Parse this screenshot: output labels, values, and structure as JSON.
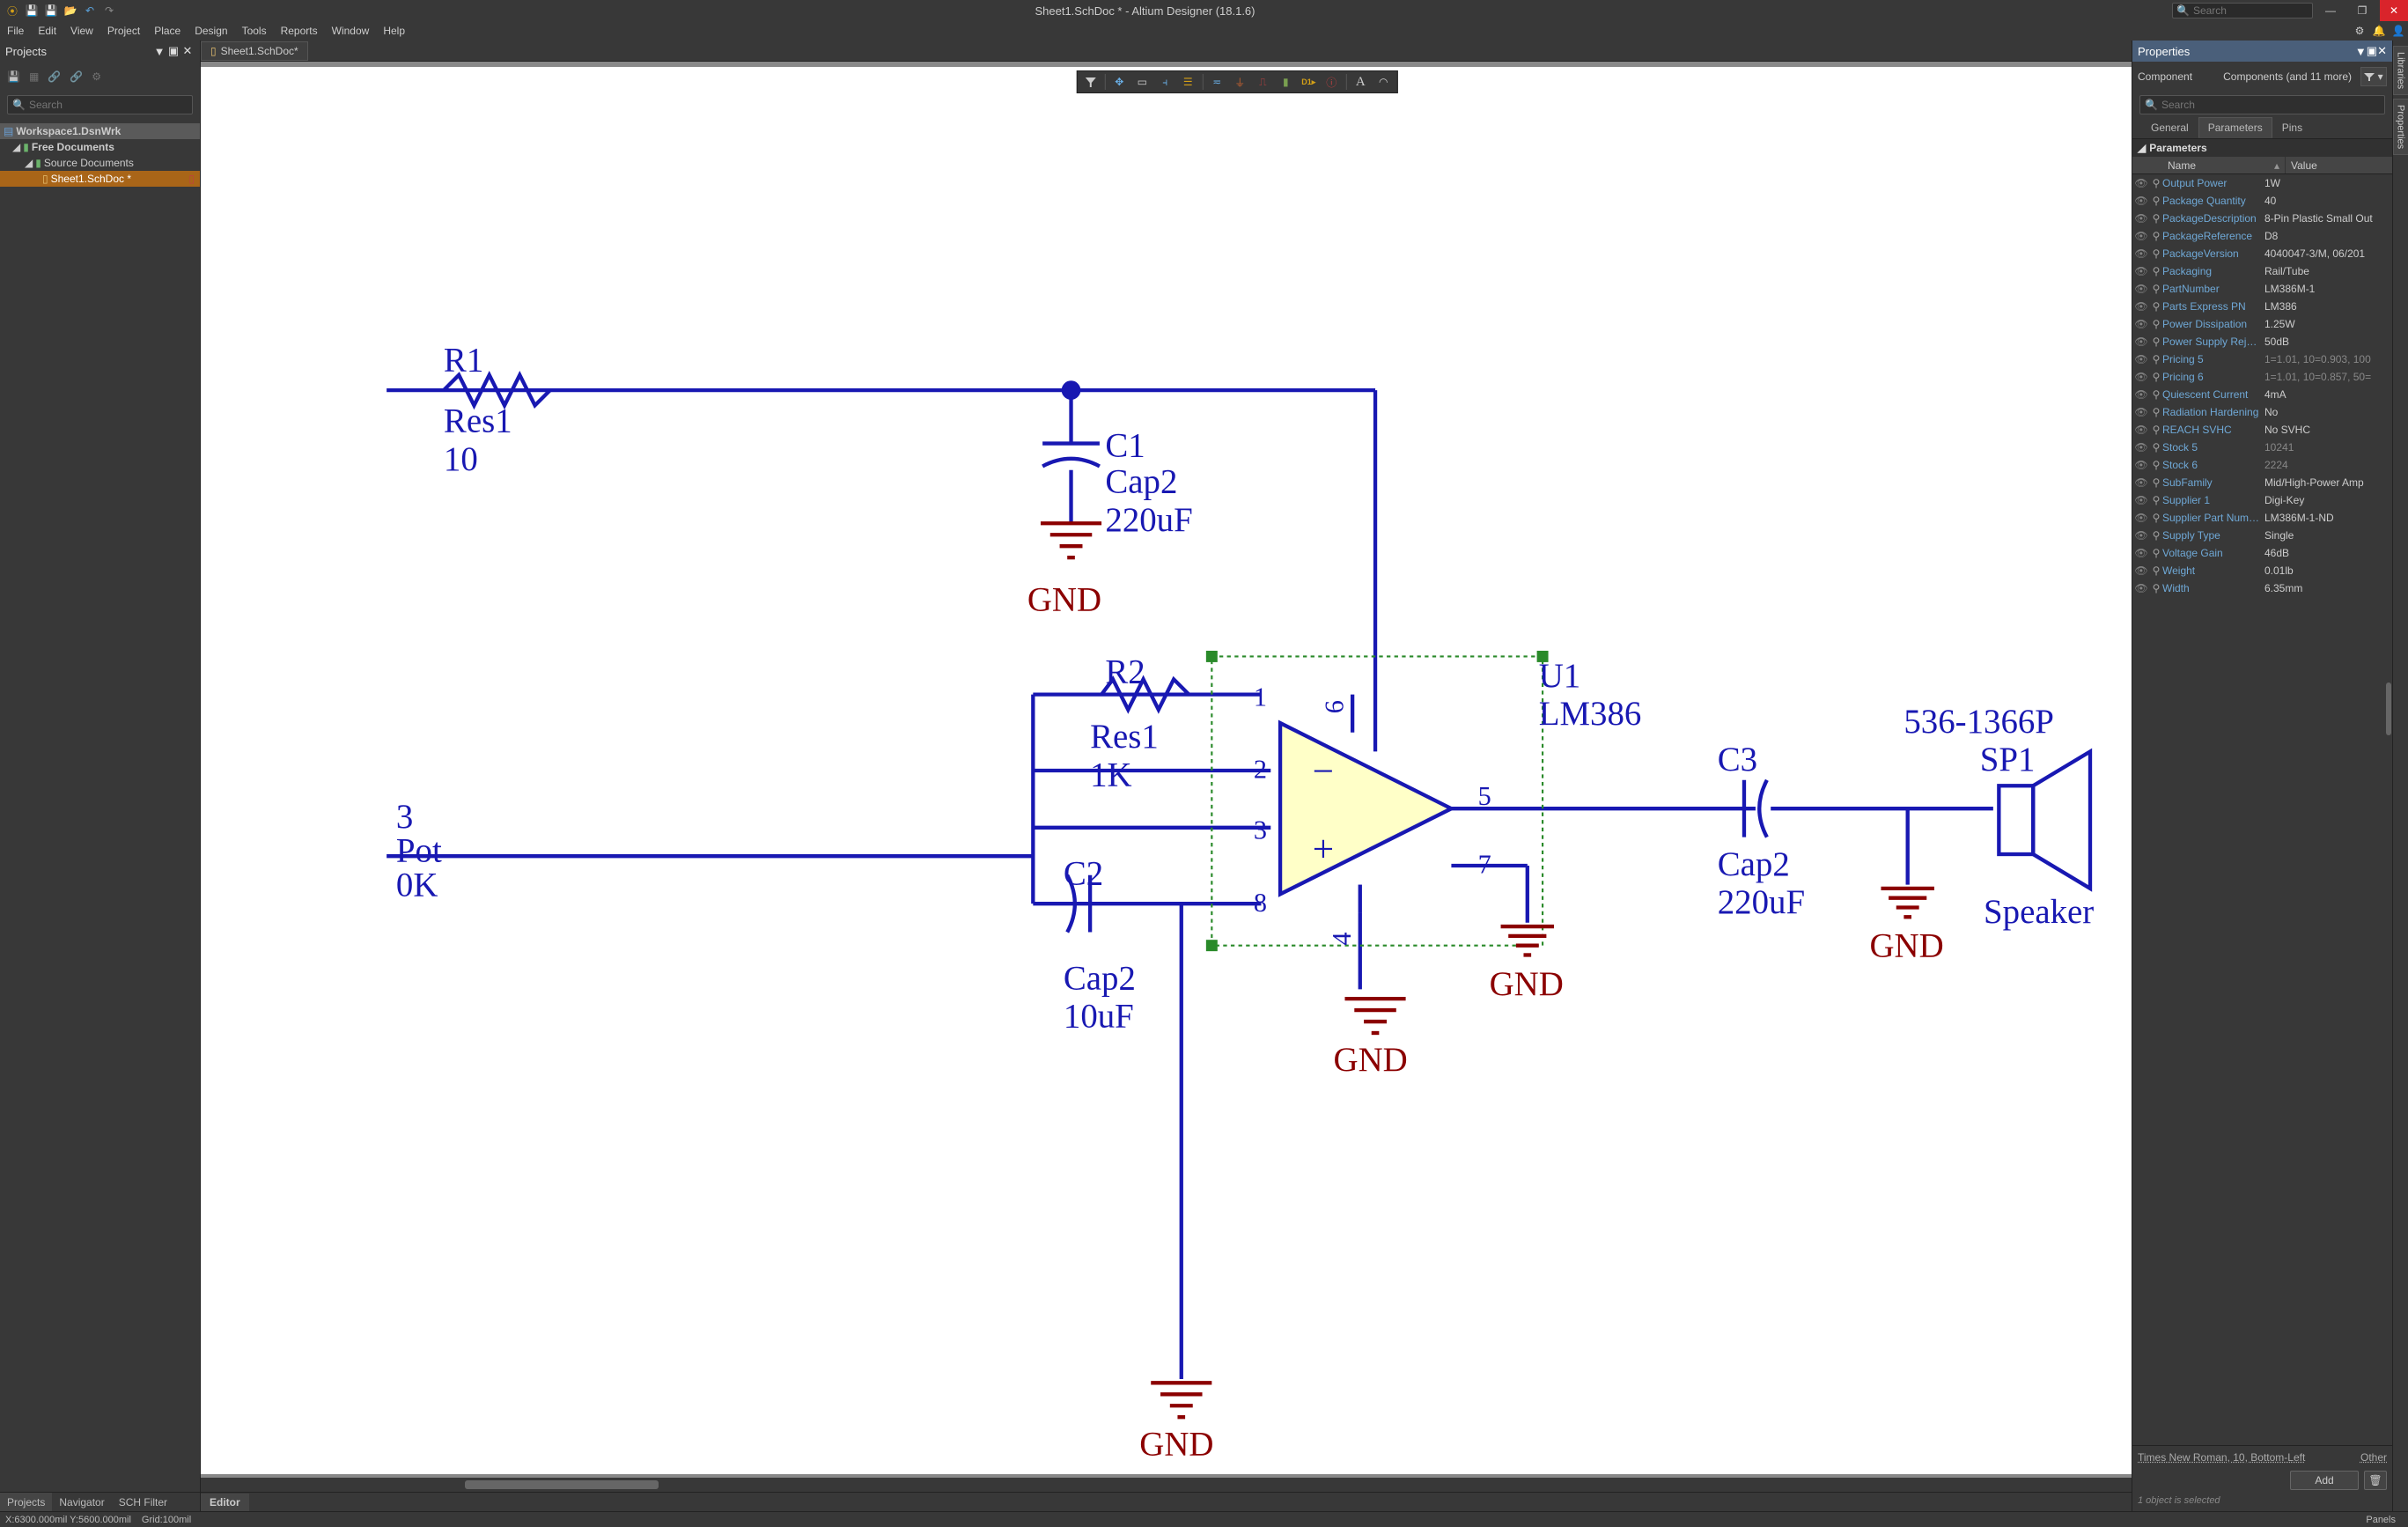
{
  "titlebar": {
    "title": "Sheet1.SchDoc * - Altium Designer (18.1.6)",
    "search_ph": "Search"
  },
  "menu": {
    "items": [
      "File",
      "Edit",
      "View",
      "Project",
      "Place",
      "Design",
      "Tools",
      "Reports",
      "Window",
      "Help"
    ]
  },
  "projects": {
    "title": "Projects",
    "search_ph": "Search",
    "workspace": "Workspace1.DsnWrk",
    "free_docs": "Free Documents",
    "source_docs": "Source Documents",
    "file": "Sheet1.SchDoc *",
    "bottom_tabs": [
      "Projects",
      "Navigator",
      "SCH Filter"
    ]
  },
  "doc": {
    "tab": "Sheet1.SchDoc*"
  },
  "editor_tab": "Editor",
  "schematic": {
    "R1": {
      "ref": "R1",
      "name": "Res1",
      "val": "10"
    },
    "R2": {
      "ref": "R2",
      "name": "Res1",
      "val": "1K"
    },
    "C1": {
      "ref": "C1",
      "name": "Cap2",
      "val": "220uF"
    },
    "C2": {
      "ref": "C2",
      "name": "Cap2",
      "val": "10uF"
    },
    "C3": {
      "ref": "C3",
      "name": "Cap2",
      "val": "220uF"
    },
    "U1": {
      "ref": "U1",
      "name": "LM386"
    },
    "SP": {
      "ref": "536-1366P",
      "name": "SP1",
      "val": "Speaker"
    },
    "POT": {
      "l1": "3",
      "l2": "Pot",
      "l3": "0K"
    },
    "GND": "GND",
    "pins": {
      "p1": "1",
      "p2": "2",
      "p3": "3",
      "p4": "4",
      "p5": "5",
      "p6": "6",
      "p7": "7",
      "p8": "8"
    }
  },
  "properties": {
    "title": "Properties",
    "type": "Component",
    "count": "Components (and 11 more)",
    "search_ph": "Search",
    "tabs": [
      "General",
      "Parameters",
      "Pins"
    ],
    "section": "Parameters",
    "col_name": "Name",
    "col_value": "Value",
    "rows": [
      {
        "n": "Output Power",
        "v": "1W"
      },
      {
        "n": "Package Quantity",
        "v": "40"
      },
      {
        "n": "PackageDescription",
        "v": "8-Pin Plastic Small Out"
      },
      {
        "n": "PackageReference",
        "v": "D8"
      },
      {
        "n": "PackageVersion",
        "v": "4040047-3/M, 06/201"
      },
      {
        "n": "Packaging",
        "v": "Rail/Tube"
      },
      {
        "n": "PartNumber",
        "v": "LM386M-1"
      },
      {
        "n": "Parts Express PN",
        "v": "LM386"
      },
      {
        "n": "Power Dissipation",
        "v": "1.25W"
      },
      {
        "n": "Power Supply Rejectio",
        "v": "50dB"
      },
      {
        "n": "Pricing 5",
        "v": "1=1.01, 10=0.903, 100",
        "dim": true
      },
      {
        "n": "Pricing 6",
        "v": "1=1.01, 10=0.857, 50=",
        "dim": true
      },
      {
        "n": "Quiescent Current",
        "v": "4mA"
      },
      {
        "n": "Radiation Hardening",
        "v": "No"
      },
      {
        "n": "REACH SVHC",
        "v": "No SVHC"
      },
      {
        "n": "Stock 5",
        "v": "10241",
        "dim": true
      },
      {
        "n": "Stock 6",
        "v": "2224",
        "dim": true
      },
      {
        "n": "SubFamily",
        "v": "Mid/High-Power Amp"
      },
      {
        "n": "Supplier 1",
        "v": "Digi-Key"
      },
      {
        "n": "Supplier Part Number",
        "v": "LM386M-1-ND"
      },
      {
        "n": "Supply Type",
        "v": "Single"
      },
      {
        "n": "Voltage Gain",
        "v": "46dB"
      },
      {
        "n": "Weight",
        "v": "0.01lb"
      },
      {
        "n": "Width",
        "v": "6.35mm"
      }
    ],
    "font_style": "Times New Roman, 10, Bottom-Left",
    "other": "Other",
    "add": "Add",
    "sel": "1 object is selected"
  },
  "side_tabs": [
    "Libraries",
    "Properties"
  ],
  "status": {
    "coords": "X:6300.000mil Y:5600.000mil",
    "grid": "Grid:100mil",
    "panels": "Panels"
  }
}
